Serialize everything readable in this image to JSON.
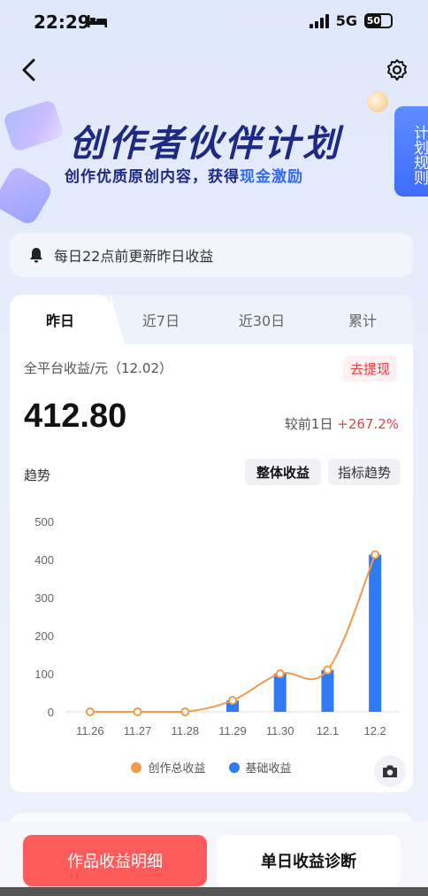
{
  "status_bar": {
    "time": "22:29",
    "network": "5G",
    "battery": "50"
  },
  "banner": {
    "title": "创作者伙伴计划",
    "subtitle_prefix": "创作优质原创内容，获得",
    "subtitle_highlight": "现金激励",
    "rules_tab": "计划规则"
  },
  "notice": {
    "text": "每日22点前更新昨日收益"
  },
  "tabs": [
    {
      "label": "昨日",
      "active": true
    },
    {
      "label": "近7日",
      "active": false
    },
    {
      "label": "近30日",
      "active": false
    },
    {
      "label": "累计",
      "active": false
    }
  ],
  "metric": {
    "label": "全平台收益/元（12.02）",
    "withdraw_label": "去提现",
    "value": "412.80",
    "compare_label": "较前1日",
    "compare_value": "+267.2%"
  },
  "trend": {
    "label": "趋势",
    "btn_overall": "整体收益",
    "btn_indicator": "指标趋势"
  },
  "chart_data": {
    "type": "bar",
    "categories": [
      "11.26",
      "11.27",
      "11.28",
      "11.29",
      "11.30",
      "12.1",
      "12.2"
    ],
    "ylim": [
      0,
      500
    ],
    "yticks": [
      0,
      100,
      200,
      300,
      400,
      500
    ],
    "series": [
      {
        "name": "创作总收益",
        "type": "line",
        "color": "#f39a4a",
        "values": [
          0,
          0,
          0,
          30,
          100,
          110,
          412.8
        ]
      },
      {
        "name": "基础收益",
        "type": "bar",
        "color": "#2f7bf5",
        "values": [
          0,
          0,
          0,
          30,
          100,
          110,
          412.8
        ]
      }
    ],
    "grid": false,
    "legend_position": "bottom"
  },
  "actions": {
    "primary": "作品收益明细",
    "secondary": "单日收益诊断"
  }
}
